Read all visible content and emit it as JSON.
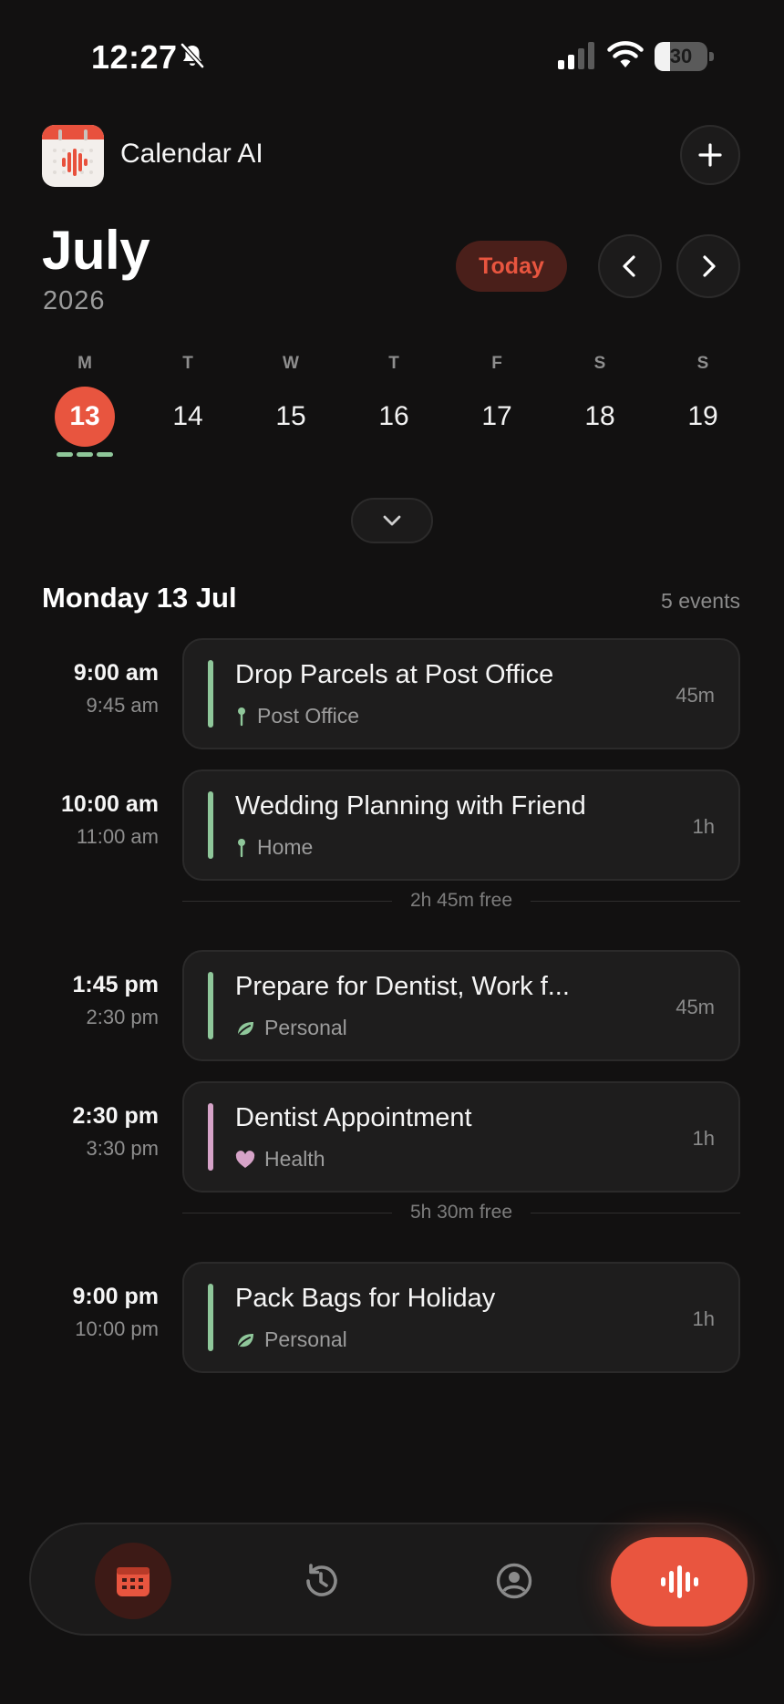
{
  "status_bar": {
    "time": "12:27",
    "battery": "30",
    "battery_level": 0.3
  },
  "header": {
    "app_name": "Calendar AI",
    "add_icon": "plus-icon"
  },
  "calendar": {
    "month": "July",
    "year": "2026",
    "today_label": "Today",
    "days": [
      {
        "dow": "M",
        "num": "13",
        "selected": true
      },
      {
        "dow": "T",
        "num": "14",
        "selected": false
      },
      {
        "dow": "W",
        "num": "15",
        "selected": false
      },
      {
        "dow": "T",
        "num": "16",
        "selected": false
      },
      {
        "dow": "F",
        "num": "17",
        "selected": false
      },
      {
        "dow": "S",
        "num": "18",
        "selected": false
      },
      {
        "dow": "S",
        "num": "19",
        "selected": false
      }
    ]
  },
  "agenda": {
    "heading": "Monday 13 Jul",
    "count": "5 events",
    "events": [
      {
        "start": "9:00 am",
        "end": "9:45 am",
        "title": "Drop Parcels at Post Office",
        "sub": "Post Office",
        "sub_icon": "pin-icon",
        "duration": "45m",
        "color": "#8fc79a"
      },
      {
        "start": "10:00 am",
        "end": "11:00 am",
        "title": "Wedding Planning with Friend",
        "sub": "Home",
        "sub_icon": "pin-icon",
        "duration": "1h",
        "color": "#8fc79a"
      },
      {
        "start": "1:45 pm",
        "end": "2:30 pm",
        "title": "Prepare for Dentist, Work f...",
        "sub": "Personal",
        "sub_icon": "leaf-icon",
        "duration": "45m",
        "color": "#8fc79a"
      },
      {
        "start": "2:30 pm",
        "end": "3:30 pm",
        "title": "Dentist Appointment",
        "sub": "Health",
        "sub_icon": "heart-icon",
        "duration": "1h",
        "color": "#d6a3c8"
      },
      {
        "start": "9:00 pm",
        "end": "10:00 pm",
        "title": "Pack Bags for Holiday",
        "sub": "Personal",
        "sub_icon": "leaf-icon",
        "duration": "1h",
        "color": "#8fc79a"
      }
    ],
    "free_gaps": [
      "2h 45m free",
      "5h 30m free"
    ]
  },
  "tabbar": {
    "tabs": [
      "calendar-icon",
      "history-icon",
      "profile-icon"
    ],
    "mic_icon": "waveform-icon"
  },
  "colors": {
    "accent": "#e8553f",
    "background": "#121111",
    "green": "#8fc79a",
    "pink": "#d6a3c8"
  }
}
